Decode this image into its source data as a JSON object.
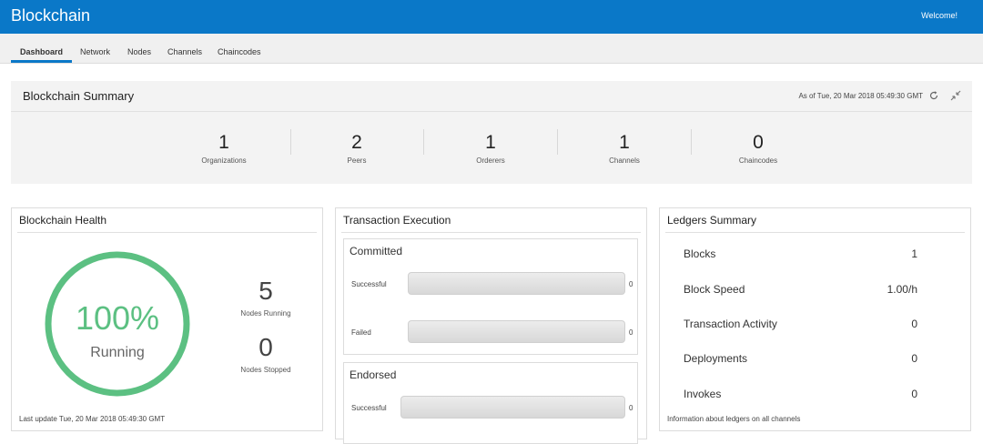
{
  "header": {
    "app_title": "Blockchain",
    "welcome": "Welcome!"
  },
  "tabs": [
    {
      "label": "Dashboard",
      "active": true
    },
    {
      "label": "Network",
      "active": false
    },
    {
      "label": "Nodes",
      "active": false
    },
    {
      "label": "Channels",
      "active": false
    },
    {
      "label": "Chaincodes",
      "active": false
    }
  ],
  "summary": {
    "title": "Blockchain Summary",
    "as_of": "As of Tue, 20 Mar 2018 05:49:30 GMT",
    "stats": [
      {
        "value": "1",
        "label": "Organizations"
      },
      {
        "value": "2",
        "label": "Peers"
      },
      {
        "value": "1",
        "label": "Orderers"
      },
      {
        "value": "1",
        "label": "Channels"
      },
      {
        "value": "0",
        "label": "Chaincodes"
      }
    ]
  },
  "health": {
    "title": "Blockchain Health",
    "percent": "100%",
    "state": "Running",
    "nodes_running_value": "5",
    "nodes_running_label": "Nodes Running",
    "nodes_stopped_value": "0",
    "nodes_stopped_label": "Nodes Stopped",
    "last_update": "Last update Tue, 20 Mar 2018 05:49:30 GMT",
    "ring_color": "#5cc082"
  },
  "transactions": {
    "title": "Transaction Execution",
    "committed": {
      "title": "Committed",
      "successful_label": "Successful",
      "successful_value": "0",
      "failed_label": "Failed",
      "failed_value": "0"
    },
    "endorsed": {
      "title": "Endorsed",
      "successful_label": "Successful",
      "successful_value": "0"
    }
  },
  "ledgers": {
    "title": "Ledgers Summary",
    "rows": [
      {
        "label": "Blocks",
        "value": "1"
      },
      {
        "label": "Block Speed",
        "value": "1.00/h"
      },
      {
        "label": "Transaction Activity",
        "value": "0"
      },
      {
        "label": "Deployments",
        "value": "0"
      },
      {
        "label": "Invokes",
        "value": "0"
      }
    ],
    "note": "Information about ledgers on all channels"
  },
  "icons": {
    "refresh": "refresh-icon",
    "collapse": "collapse-icon"
  },
  "colors": {
    "brand": "#0a78c8",
    "health_green": "#5cc082"
  }
}
